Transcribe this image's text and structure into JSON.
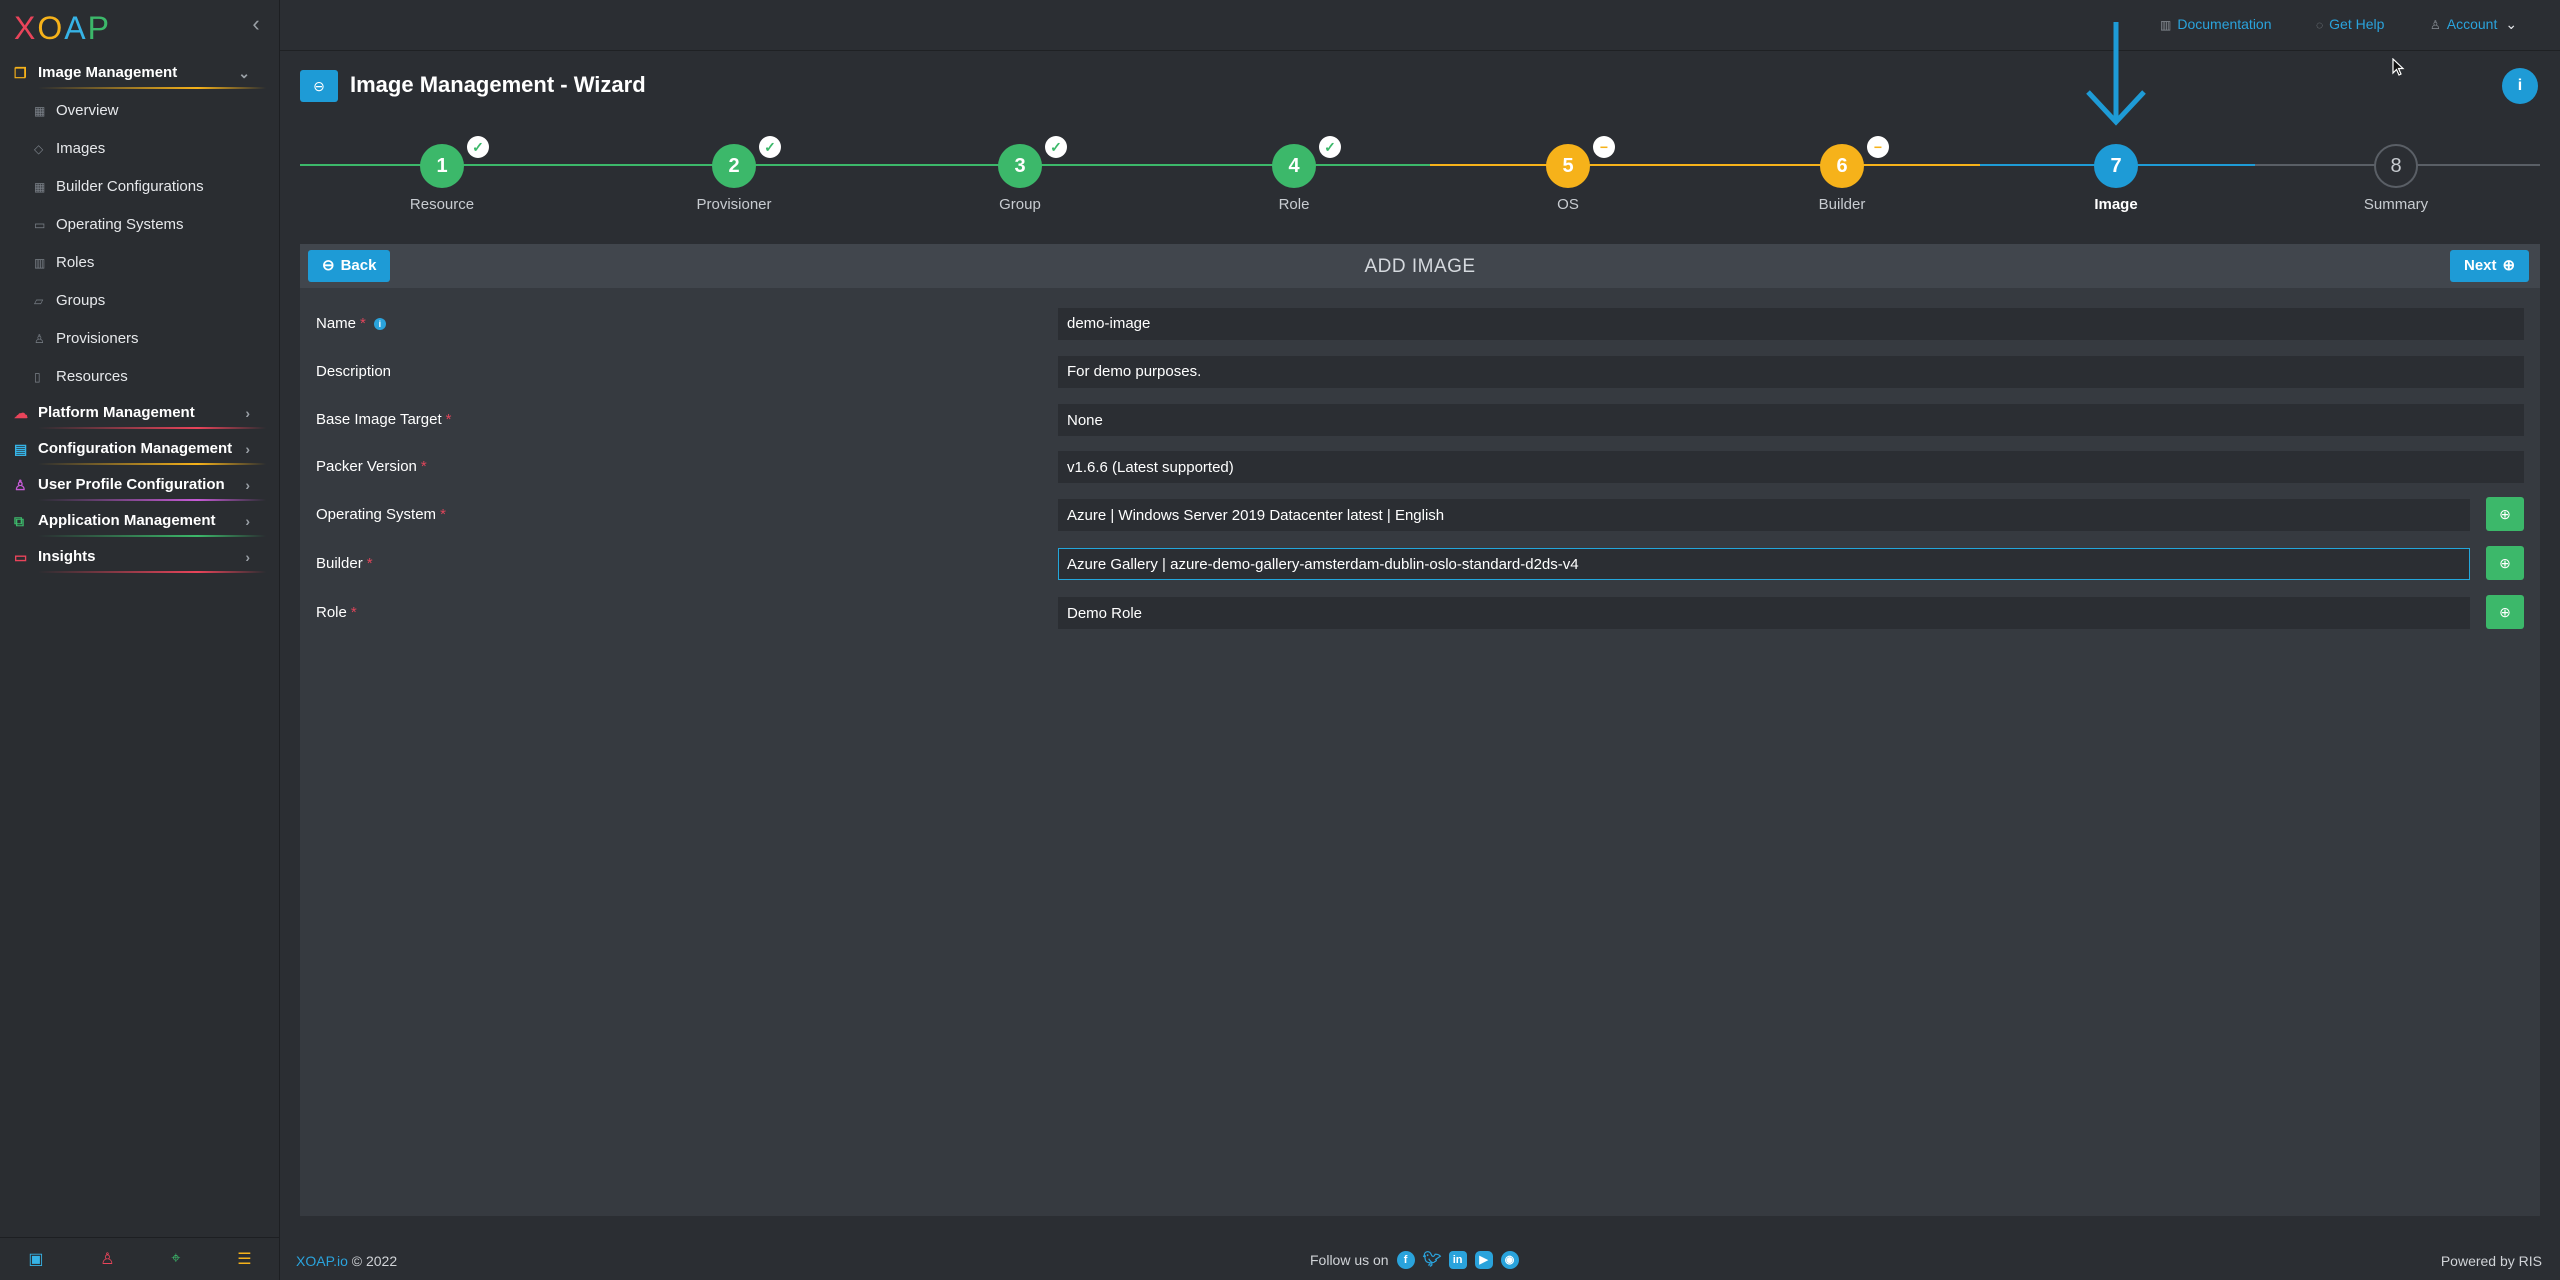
{
  "app": {
    "logo_letters": [
      "X",
      "O",
      "A",
      "P"
    ],
    "logo_colors": [
      "#e9445a",
      "#f6b21a",
      "#36b3e6",
      "#3cb86a"
    ]
  },
  "sidebar": {
    "sections": [
      {
        "label": "Image Management",
        "icon": "image-stack-icon",
        "color": "#f6b21a",
        "expanded": true,
        "items": [
          {
            "label": "Overview",
            "icon": "grid-icon"
          },
          {
            "label": "Images",
            "icon": "diamond-icon"
          },
          {
            "label": "Builder Configurations",
            "icon": "grid-icon"
          },
          {
            "label": "Operating Systems",
            "icon": "monitor-icon"
          },
          {
            "label": "Roles",
            "icon": "book-icon"
          },
          {
            "label": "Groups",
            "icon": "folder-icon"
          },
          {
            "label": "Provisioners",
            "icon": "user-icon"
          },
          {
            "label": "Resources",
            "icon": "file-icon"
          }
        ]
      },
      {
        "label": "Platform Management",
        "icon": "cloud-icon",
        "color": "#e9445a",
        "expanded": false
      },
      {
        "label": "Configuration Management",
        "icon": "layers-icon",
        "color": "#36b3e6",
        "expanded": false
      },
      {
        "label": "User Profile Configuration",
        "icon": "user-icon",
        "color": "#c65bd6",
        "expanded": false
      },
      {
        "label": "Application Management",
        "icon": "sitemap-icon",
        "color": "#3cb86a",
        "expanded": false
      },
      {
        "label": "Insights",
        "icon": "monitor-icon",
        "color": "#e9445a",
        "expanded": false
      }
    ]
  },
  "topbar": {
    "documentation": "Documentation",
    "get_help": "Get Help",
    "account": "Account"
  },
  "page": {
    "title": "Image Management - Wizard"
  },
  "stepper": {
    "steps": [
      {
        "number": "1",
        "label": "Resource",
        "status": "complete"
      },
      {
        "number": "2",
        "label": "Provisioner",
        "status": "complete"
      },
      {
        "number": "3",
        "label": "Group",
        "status": "complete"
      },
      {
        "number": "4",
        "label": "Role",
        "status": "complete"
      },
      {
        "number": "5",
        "label": "OS",
        "status": "skipped"
      },
      {
        "number": "6",
        "label": "Builder",
        "status": "skipped"
      },
      {
        "number": "7",
        "label": "Image",
        "status": "active"
      },
      {
        "number": "8",
        "label": "Summary",
        "status": "pending"
      }
    ],
    "colors": {
      "complete": "#3cb86a",
      "skipped": "#f6b21a",
      "active": "#1e9bd6",
      "pending": "#2b2e33"
    }
  },
  "panel": {
    "title": "ADD IMAGE",
    "back_label": "Back",
    "next_label": "Next"
  },
  "form": {
    "fields": [
      {
        "label": "Name",
        "required": true,
        "info": true,
        "value": "demo-image"
      },
      {
        "label": "Description",
        "required": false,
        "value": "For demo purposes."
      },
      {
        "label": "Base Image Target",
        "required": true,
        "value": "None"
      },
      {
        "label": "Packer Version",
        "required": true,
        "value": "v1.6.6 (Latest supported)"
      },
      {
        "label": "Operating System",
        "required": true,
        "value": "Azure | Windows Server 2019 Datacenter latest | English",
        "add_button": true
      },
      {
        "label": "Builder",
        "required": true,
        "value": "Azure Gallery | azure-demo-gallery-amsterdam-dublin-oslo-standard-d2ds-v4",
        "add_button": true,
        "focused": true
      },
      {
        "label": "Role",
        "required": true,
        "value": "Demo Role",
        "add_button": true
      }
    ]
  },
  "footer": {
    "brand": "XOAP.io",
    "copyright": "© 2022",
    "follow": "Follow us on",
    "socials": [
      "facebook-icon",
      "twitter-icon",
      "linkedin-icon",
      "youtube-icon",
      "github-icon"
    ],
    "powered": "Powered by RIS"
  }
}
